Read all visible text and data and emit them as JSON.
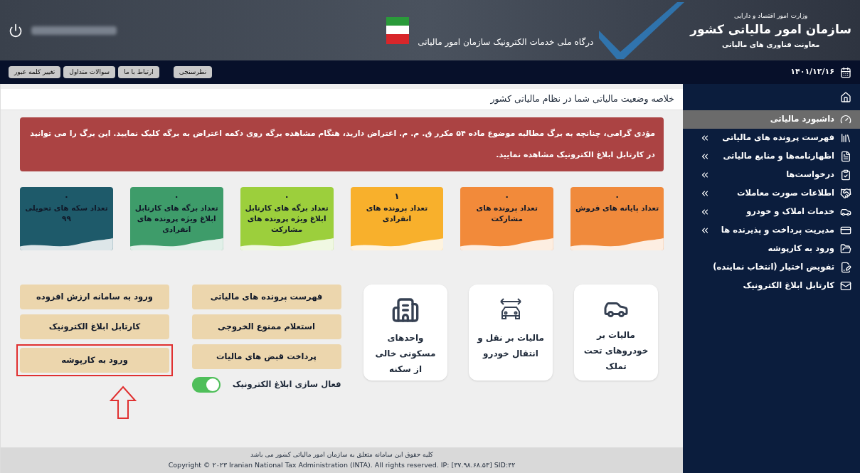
{
  "header": {
    "ministry": "وزارت امور اقتصاد و دارایی",
    "org": "سازمان امور مالیاتی کشور",
    "deputy": "معاونت فناوری های مالیاتی",
    "portal": "درگاه ملی خدمات الکترونیک سازمان امور مالیاتی"
  },
  "toolbar": {
    "date": "۱۴۰۱/۱۲/۱۶",
    "links": [
      "نظرسنجی",
      "ارتباط با ما",
      "سوالات متداول",
      "تغییر کلمه عبور"
    ]
  },
  "sidebar": {
    "items": [
      {
        "label": "داشبورد مالیاتی",
        "selected": true,
        "submenu": false
      },
      {
        "label": "فهرست پرونده های مالیاتی",
        "selected": false,
        "submenu": true
      },
      {
        "label": "اظهارنامه‌ها و منابع مالیاتی",
        "selected": false,
        "submenu": true
      },
      {
        "label": "درخواست‌ها",
        "selected": false,
        "submenu": true
      },
      {
        "label": "اطلاعات صورت معاملات",
        "selected": false,
        "submenu": true
      },
      {
        "label": "خدمات املاک و خودرو",
        "selected": false,
        "submenu": true
      },
      {
        "label": "مدیریت پرداخت و پذیرنده ها",
        "selected": false,
        "submenu": true
      },
      {
        "label": "ورود به کارپوشه",
        "selected": false,
        "submenu": false
      },
      {
        "label": "تفویض اختیار (انتخاب نماینده)",
        "selected": false,
        "submenu": false
      },
      {
        "label": "کارتابل ابلاغ الکترونیک",
        "selected": false,
        "submenu": false
      }
    ]
  },
  "main": {
    "title": "خلاصه وضعیت مالیاتی شما در نظام مالیاتی کشور",
    "alert": "مؤدی گرامی، چنانچه به برگ مطالبه موضوع ماده ۵۴ مکرر ق. م. م. اعتراض دارید، هنگام مشاهده برگه روی دکمه اعتراض به برگه کلیک نمایید. این برگ را می توانید در کارتابل ابلاغ الکترونیک مشاهده نمایید.",
    "stats": [
      {
        "count": "۰",
        "label": "تعداد پایانه های فروش",
        "color": "#f08a3c"
      },
      {
        "count": "۰",
        "label": "تعداد پرونده های مشارکت",
        "color": "#f28a3a"
      },
      {
        "count": "۱",
        "label": "تعداد پرونده های انفرادی",
        "color": "#f8b02c"
      },
      {
        "count": "۰",
        "label": "تعداد برگه های کارتابل ابلاغ ویژه پرونده های مشارکت",
        "color": "#9ccf3c"
      },
      {
        "count": "۰",
        "label": "تعداد برگه های کارتابل ابلاغ ویژه پرونده های انفرادی",
        "color": "#3e9c6a"
      },
      {
        "count": "۰",
        "label": "تعداد سکه های تحویلی ۹۹",
        "color": "#1e5a6a"
      }
    ],
    "tiles": [
      {
        "label": "مالیات بر خودروهای تحت تملک",
        "kind": "car"
      },
      {
        "label": "مالیات بر نقل و انتقال خودرو",
        "kind": "transfer"
      },
      {
        "label": "واحدهای مسکونی خالی از سکنه",
        "kind": "building"
      }
    ],
    "actions": [
      "فهرست پرونده های مالیاتی",
      "استعلام ممنوع الخروجی",
      "پرداخت قبض های مالیات"
    ],
    "toggle": {
      "label": "فعال سازی ابلاغ الکترونیک",
      "on": true
    },
    "links": [
      {
        "label": "ورود به سامانه ارزش افزوده",
        "highlighted": false
      },
      {
        "label": "کارتابل ابلاغ الکترونیک",
        "highlighted": false
      },
      {
        "label": "ورود به کارپوشه",
        "highlighted": true
      }
    ]
  },
  "footer": {
    "rights": "کلیه حقوق این سامانه متعلق به سازمان امور مالیاتی کشور می باشد",
    "copyright": "Copyright © ۲۰۲۳ Iranian National Tax Administration (INTA). All rights reserved. IP: [۳۷.۹۸.۶۸.۵۳] SID:۴۲"
  }
}
